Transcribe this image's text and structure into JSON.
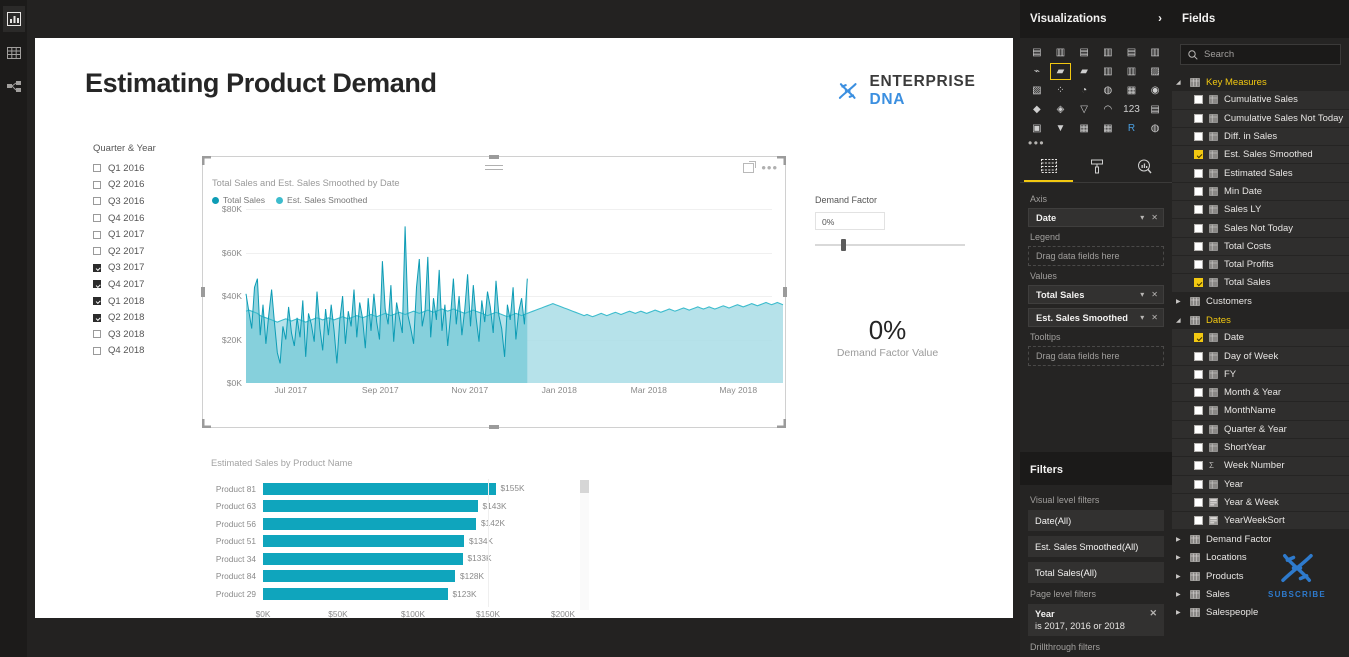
{
  "rail": {
    "items": [
      {
        "name": "report-view",
        "icon": "bar-chart-icon",
        "active": true
      },
      {
        "name": "data-view",
        "icon": "table-icon",
        "active": false
      },
      {
        "name": "model-view",
        "icon": "model-relationship-icon",
        "active": false
      }
    ]
  },
  "report": {
    "title": "Estimating Product Demand",
    "logo": {
      "primary": "ENTERPRISE",
      "secondary": "DNA",
      "icon": "dna-helix-icon"
    }
  },
  "slicer": {
    "title": "Quarter & Year",
    "items": [
      {
        "label": "Q1 2016",
        "checked": false
      },
      {
        "label": "Q2 2016",
        "checked": false
      },
      {
        "label": "Q3 2016",
        "checked": false
      },
      {
        "label": "Q4 2016",
        "checked": false
      },
      {
        "label": "Q1 2017",
        "checked": false
      },
      {
        "label": "Q2 2017",
        "checked": false
      },
      {
        "label": "Q3 2017",
        "checked": true
      },
      {
        "label": "Q4 2017",
        "checked": true
      },
      {
        "label": "Q1 2018",
        "checked": true
      },
      {
        "label": "Q2 2018",
        "checked": true
      },
      {
        "label": "Q3 2018",
        "checked": false
      },
      {
        "label": "Q4 2018",
        "checked": false
      }
    ]
  },
  "demand_factor": {
    "label": "Demand Factor",
    "input_value": "0%",
    "card_value": "0%",
    "card_label": "Demand Factor Value",
    "slider_position_pct": 17
  },
  "visualizations_pane": {
    "header": "Visualizations",
    "chevron": "chevron-right-icon",
    "selected_visual_index": 7,
    "icons": [
      "stacked-bar-chart-icon",
      "stacked-column-chart-icon",
      "clustered-bar-chart-icon",
      "clustered-column-chart-icon",
      "hundred-stacked-bar-icon",
      "hundred-stacked-column-icon",
      "line-chart-icon",
      "area-chart-icon",
      "stacked-area-chart-icon",
      "line-stacked-column-icon",
      "line-clustered-column-icon",
      "ribbon-chart-icon",
      "waterfall-chart-icon",
      "scatter-chart-icon",
      "pie-chart-icon",
      "donut-chart-icon",
      "treemap-icon",
      "map-icon",
      "filled-map-icon",
      "shape-map-icon",
      "funnel-icon",
      "gauge-icon",
      "card-icon",
      "multi-row-card-icon",
      "kpi-icon",
      "slicer-icon",
      "table-icon",
      "matrix-icon",
      "r-script-visual-icon",
      "python-visual-icon"
    ],
    "more_icon": "ellipsis-icon",
    "tabs": [
      {
        "name": "fields-tab",
        "icon": "fields-table-icon",
        "active": true
      },
      {
        "name": "format-tab",
        "icon": "paint-roller-icon",
        "active": false
      },
      {
        "name": "analytics-tab",
        "icon": "magnifier-chart-icon",
        "active": false
      }
    ],
    "wells": [
      {
        "label": "Axis",
        "type": "chips",
        "chips": [
          "Date"
        ]
      },
      {
        "label": "Legend",
        "type": "drop",
        "placeholder": "Drag data fields here"
      },
      {
        "label": "Values",
        "type": "chips",
        "chips": [
          "Total Sales",
          "Est. Sales Smoothed"
        ]
      },
      {
        "label": "Tooltips",
        "type": "drop",
        "placeholder": "Drag data fields here"
      }
    ]
  },
  "filters_pane": {
    "header": "Filters",
    "visual_level_label": "Visual level filters",
    "visual_level_filters": [
      "Date(All)",
      "Est. Sales Smoothed(All)",
      "Total Sales(All)"
    ],
    "page_level_label": "Page level filters",
    "page_level_filter": {
      "field": "Year",
      "condition": "is 2017, 2016 or 2018",
      "remove_icon": "close-icon"
    },
    "drillthrough_label": "Drillthrough filters"
  },
  "fields_pane": {
    "header": "Fields",
    "search_placeholder": "Search",
    "search_icon": "search-icon",
    "groups": [
      {
        "name": "Key Measures",
        "highlighted": true,
        "expanded": true,
        "icon": "measure-table-icon",
        "items": [
          {
            "label": "Cumulative Sales",
            "checked": false,
            "icon": "measure-icon"
          },
          {
            "label": "Cumulative Sales Not Today",
            "checked": false,
            "icon": "measure-icon"
          },
          {
            "label": "Diff. in Sales",
            "checked": false,
            "icon": "measure-icon"
          },
          {
            "label": "Est. Sales Smoothed",
            "checked": true,
            "icon": "measure-icon"
          },
          {
            "label": "Estimated Sales",
            "checked": false,
            "icon": "measure-icon"
          },
          {
            "label": "Min Date",
            "checked": false,
            "icon": "measure-icon"
          },
          {
            "label": "Sales LY",
            "checked": false,
            "icon": "measure-icon"
          },
          {
            "label": "Sales Not Today",
            "checked": false,
            "icon": "measure-icon"
          },
          {
            "label": "Total Costs",
            "checked": false,
            "icon": "measure-icon"
          },
          {
            "label": "Total Profits",
            "checked": false,
            "icon": "measure-icon"
          },
          {
            "label": "Total Sales",
            "checked": true,
            "icon": "measure-icon"
          }
        ]
      },
      {
        "name": "Customers",
        "highlighted": false,
        "expanded": false,
        "icon": "table-icon",
        "items": []
      },
      {
        "name": "Dates",
        "highlighted": true,
        "expanded": true,
        "icon": "table-icon",
        "items": [
          {
            "label": "Date",
            "checked": true,
            "icon": "column-icon"
          },
          {
            "label": "Day of Week",
            "checked": false,
            "icon": "column-icon"
          },
          {
            "label": "FY",
            "checked": false,
            "icon": "column-icon"
          },
          {
            "label": "Month & Year",
            "checked": false,
            "icon": "column-icon"
          },
          {
            "label": "MonthName",
            "checked": false,
            "icon": "column-icon"
          },
          {
            "label": "Quarter & Year",
            "checked": false,
            "icon": "column-icon"
          },
          {
            "label": "ShortYear",
            "checked": false,
            "icon": "column-icon"
          },
          {
            "label": "Week Number",
            "checked": false,
            "icon": "sigma-icon"
          },
          {
            "label": "Year",
            "checked": false,
            "icon": "column-icon"
          },
          {
            "label": "Year & Week",
            "checked": false,
            "icon": "hierarchy-icon"
          },
          {
            "label": "YearWeekSort",
            "checked": false,
            "icon": "hierarchy-icon"
          }
        ]
      },
      {
        "name": "Demand Factor",
        "highlighted": false,
        "expanded": false,
        "icon": "table-icon",
        "items": []
      },
      {
        "name": "Locations",
        "highlighted": false,
        "expanded": false,
        "icon": "table-icon",
        "items": []
      },
      {
        "name": "Products",
        "highlighted": false,
        "expanded": false,
        "icon": "table-icon",
        "items": []
      },
      {
        "name": "Sales",
        "highlighted": false,
        "expanded": false,
        "icon": "table-icon",
        "items": []
      },
      {
        "name": "Salespeople",
        "highlighted": false,
        "expanded": false,
        "icon": "table-icon",
        "items": []
      }
    ],
    "watermark": {
      "text": "SUBSCRIBE",
      "icon": "dna-helix-icon"
    }
  },
  "colors": {
    "total_sales": "#0d9cb5",
    "est_sales_smoothed": "#3dbccd",
    "est_sales_fill": "#a9dde6",
    "bar": "#0fa5bd",
    "accent_yellow": "#f2c811",
    "logo_blue": "#3b8fe0"
  },
  "chart_data": [
    {
      "type": "area",
      "title": "Total Sales and Est. Sales Smoothed by Date",
      "xlabel": "",
      "ylabel": "",
      "ylim": [
        0,
        80000
      ],
      "yticks": [
        "$0K",
        "$20K",
        "$40K",
        "$60K",
        "$80K"
      ],
      "ytick_values": [
        0,
        20000,
        40000,
        60000,
        80000
      ],
      "xticks": [
        "Jul 2017",
        "Sep 2017",
        "Nov 2017",
        "Jan 2018",
        "Mar 2018",
        "May 2018"
      ],
      "grid": true,
      "legend": [
        "Total Sales",
        "Est. Sales Smoothed"
      ],
      "legend_position": "top-left",
      "series": [
        {
          "name": "Total Sales",
          "note": "Daily volatile series, visible Jul 2017 through mid Jan 2018 only",
          "values": [
            41000,
            33000,
            25000,
            44000,
            48000,
            22000,
            36000,
            18000,
            31000,
            43000,
            28000,
            14000,
            9000,
            26000,
            20000,
            35000,
            23000,
            17000,
            30000,
            21000,
            38000,
            12000,
            32000,
            27000,
            19000,
            42000,
            25000,
            15000,
            34000,
            22000,
            36000,
            24000,
            9000,
            29000,
            40000,
            18000,
            33000,
            26000,
            43000,
            21000,
            37000,
            30000,
            16000,
            39000,
            24000,
            41000,
            28000,
            20000,
            56000,
            34000,
            27000,
            45000,
            19000,
            37000,
            30000,
            23000,
            72000,
            31000,
            25000,
            18000,
            44000,
            57000,
            26000,
            33000,
            58000,
            21000,
            39000,
            29000,
            52000,
            24000,
            36000,
            17000,
            31000,
            48000,
            27000,
            40000,
            22000,
            34000,
            50000,
            26000,
            45000,
            30000,
            19000,
            38000,
            28000,
            42000,
            35000,
            23000,
            47000,
            31000,
            25000,
            12000,
            36000,
            29000,
            44000,
            20000,
            33000,
            39000,
            27000,
            48000,
            22000,
            35000,
            30000,
            18000,
            41000,
            26000,
            37000,
            32000,
            24000,
            43000,
            29000,
            21000,
            38000,
            34000,
            27000,
            56000,
            31000,
            25000,
            42000,
            19000,
            36000,
            30000,
            64000,
            28000,
            23000,
            39000,
            33000,
            67000,
            26000,
            44000,
            31000,
            20000,
            37000,
            29000,
            48000,
            35000,
            24000,
            41000,
            27000,
            52000,
            32000,
            22000,
            38000,
            30000,
            59000,
            26000,
            43000,
            34000,
            21000,
            40000,
            28000,
            36000,
            25000,
            33000,
            46000,
            29000,
            23000,
            39000,
            31000,
            27000,
            44000,
            35000,
            20000,
            38000,
            30000,
            50000,
            26000,
            42000,
            33000,
            24000,
            39000,
            28000,
            13000,
            36000,
            31000,
            45000,
            22000,
            34000,
            29000,
            40000,
            27000,
            37000,
            32000,
            25000,
            43000,
            30000,
            19000,
            38000,
            35000,
            28000
          ]
        },
        {
          "name": "Est. Sales Smoothed",
          "note": "Smoothed estimate spanning the full Jul 2017 - Jun 2018 range",
          "values": [
            33000,
            33500,
            33000,
            32500,
            32000,
            31000,
            30500,
            30000,
            29500,
            29000,
            28500,
            28000,
            28500,
            29000,
            29500,
            29000,
            28500,
            29000,
            29500,
            29000,
            28500,
            28000,
            28500,
            29000,
            29500,
            30000,
            29500,
            29000,
            29500,
            30000,
            29500,
            29000,
            29500,
            30000,
            30500,
            30000,
            29500,
            30000,
            30500,
            31000,
            30500,
            30000,
            30500,
            31000,
            31500,
            31000,
            30500,
            31000,
            31500,
            32000,
            31500,
            31000,
            31500,
            32000,
            32500,
            32000,
            31500,
            32000,
            32500,
            33000,
            32500,
            32000,
            32500,
            33000,
            33500,
            33000,
            32500,
            33000,
            33500,
            34000,
            33500,
            33000,
            33500,
            34000,
            33500,
            33000,
            32500,
            32000,
            32500,
            33000,
            33500,
            33000,
            32500,
            32000,
            31500,
            31000,
            31500,
            32000,
            32500,
            32000,
            31500,
            31000,
            30500,
            31000,
            31500,
            32000,
            31500,
            31000,
            31500,
            32000,
            32500,
            33000,
            33500,
            34000,
            34500,
            35000,
            35500,
            36000,
            36500,
            36000,
            35500,
            35000,
            34500,
            34000,
            33500,
            33000,
            32500,
            32000,
            31500,
            31000,
            31500,
            31000,
            30500,
            31000,
            31500,
            32000,
            31500,
            31000,
            31500,
            32000,
            32500,
            32000,
            31500,
            32000,
            32500,
            33000,
            32500,
            32000,
            32500,
            33000,
            32500,
            32000,
            32500,
            33000,
            33500,
            33000,
            32500,
            33000,
            33500,
            34000,
            33500,
            33000,
            33500,
            34000,
            34500,
            34000,
            33500,
            34000,
            34500,
            35000,
            34500,
            34000,
            34500,
            35000,
            34500,
            34000,
            34500,
            35000,
            35500,
            35000,
            34500,
            35000,
            35500,
            36000,
            35500,
            35000,
            35500,
            36000,
            36500,
            36000,
            35500,
            36000,
            36500,
            37000,
            36500,
            36000,
            36500,
            37000,
            36500,
            36000
          ]
        }
      ],
      "header_icons": [
        "drag-handle-icon",
        "focus-mode-icon",
        "more-options-icon"
      ]
    },
    {
      "type": "bar",
      "title": "Estimated Sales by Product Name",
      "orientation": "horizontal",
      "categories": [
        "Product 81",
        "Product 63",
        "Product 56",
        "Product 51",
        "Product 34",
        "Product 84",
        "Product 29"
      ],
      "values": [
        155000,
        143000,
        142000,
        134000,
        133000,
        128000,
        123000
      ],
      "data_labels": [
        "$155K",
        "$143K",
        "$142K",
        "$134K",
        "$133K",
        "$128K",
        "$123K"
      ],
      "xticks": [
        "$0K",
        "$50K",
        "$100K",
        "$150K",
        "$200K"
      ],
      "xtick_values": [
        0,
        50000,
        100000,
        150000,
        200000
      ],
      "xlim": [
        0,
        200000
      ],
      "grid": true
    }
  ]
}
